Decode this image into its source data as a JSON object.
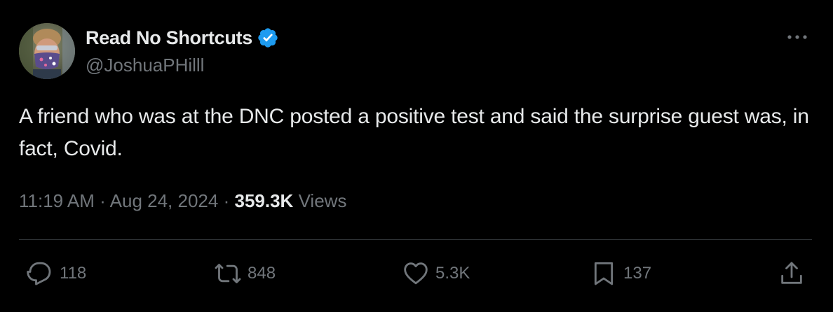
{
  "author": {
    "display_name": "Read No Shortcuts",
    "handle": "@JoshuaPHilll",
    "verified": true
  },
  "tweet": {
    "text": "A friend who was at the DNC posted a positive test and said the surprise guest was, in fact, Covid.",
    "time": "11:19 AM",
    "separator": "·",
    "date": "Aug 24, 2024",
    "views_count": "359.3K",
    "views_label": "Views"
  },
  "actions": {
    "replies": "118",
    "reposts": "848",
    "likes": "5.3K",
    "bookmarks": "137"
  },
  "colors": {
    "background": "#000000",
    "text": "#e7e9ea",
    "muted": "#71767b",
    "verified_blue": "#1d9bf0",
    "divider": "#2f3336"
  },
  "icons": {
    "more": "more-horizontal-icon",
    "reply": "reply-icon",
    "repost": "repost-icon",
    "like": "heart-icon",
    "bookmark": "bookmark-icon",
    "share": "share-icon",
    "verified": "verified-badge-icon"
  }
}
